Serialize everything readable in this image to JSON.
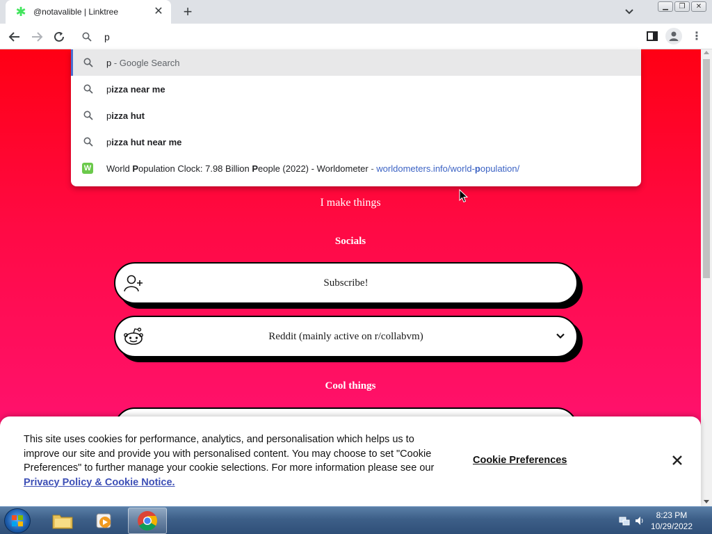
{
  "browser": {
    "tab_title": "@notavalible | Linktree",
    "omnibox_text": "p"
  },
  "suggestions": [
    {
      "prefix": "p",
      "rest": "",
      "suffix": " - Google Search"
    },
    {
      "prefix": "p",
      "rest": "izza near me"
    },
    {
      "prefix": "p",
      "rest": "izza hut"
    },
    {
      "prefix": "p",
      "rest": "izza hut near me"
    }
  ],
  "history_suggestion": {
    "title_parts": [
      "World ",
      "P",
      "opulation Clock: 7.98 Billion ",
      "P",
      "eople (2022) - Worldometer"
    ],
    "sep": " - ",
    "url_parts": [
      "worldometers.info/world-",
      "p",
      "opulation/"
    ],
    "favicon_letter": "W"
  },
  "page": {
    "bio": "I make things",
    "socials_heading": "Socials",
    "links": [
      {
        "label": "Subscribe!",
        "icon": "add-person-icon"
      },
      {
        "label": "Reddit (mainly active on r/collabvm)",
        "icon": "reddit-icon"
      }
    ],
    "cool_things_heading": "Cool things"
  },
  "cookie_banner": {
    "message": "This site uses cookies for performance, analytics, and personalisation which helps us to improve our site and provide you with personalised content. You may choose to set \"Cookie Preferences\" to further manage your cookie selections. For more information please see our ",
    "policy_link": "Privacy Policy & Cookie Notice.",
    "prefs_label": "Cookie Preferences"
  },
  "taskbar": {
    "time": "8:23 PM",
    "date": "10/29/2022"
  },
  "colors": {
    "linktree_green": "#43e55e",
    "page_gradient_top": "#ff0014",
    "page_gradient_bottom": "#ff157e",
    "link_blue": "#3c63c4"
  }
}
